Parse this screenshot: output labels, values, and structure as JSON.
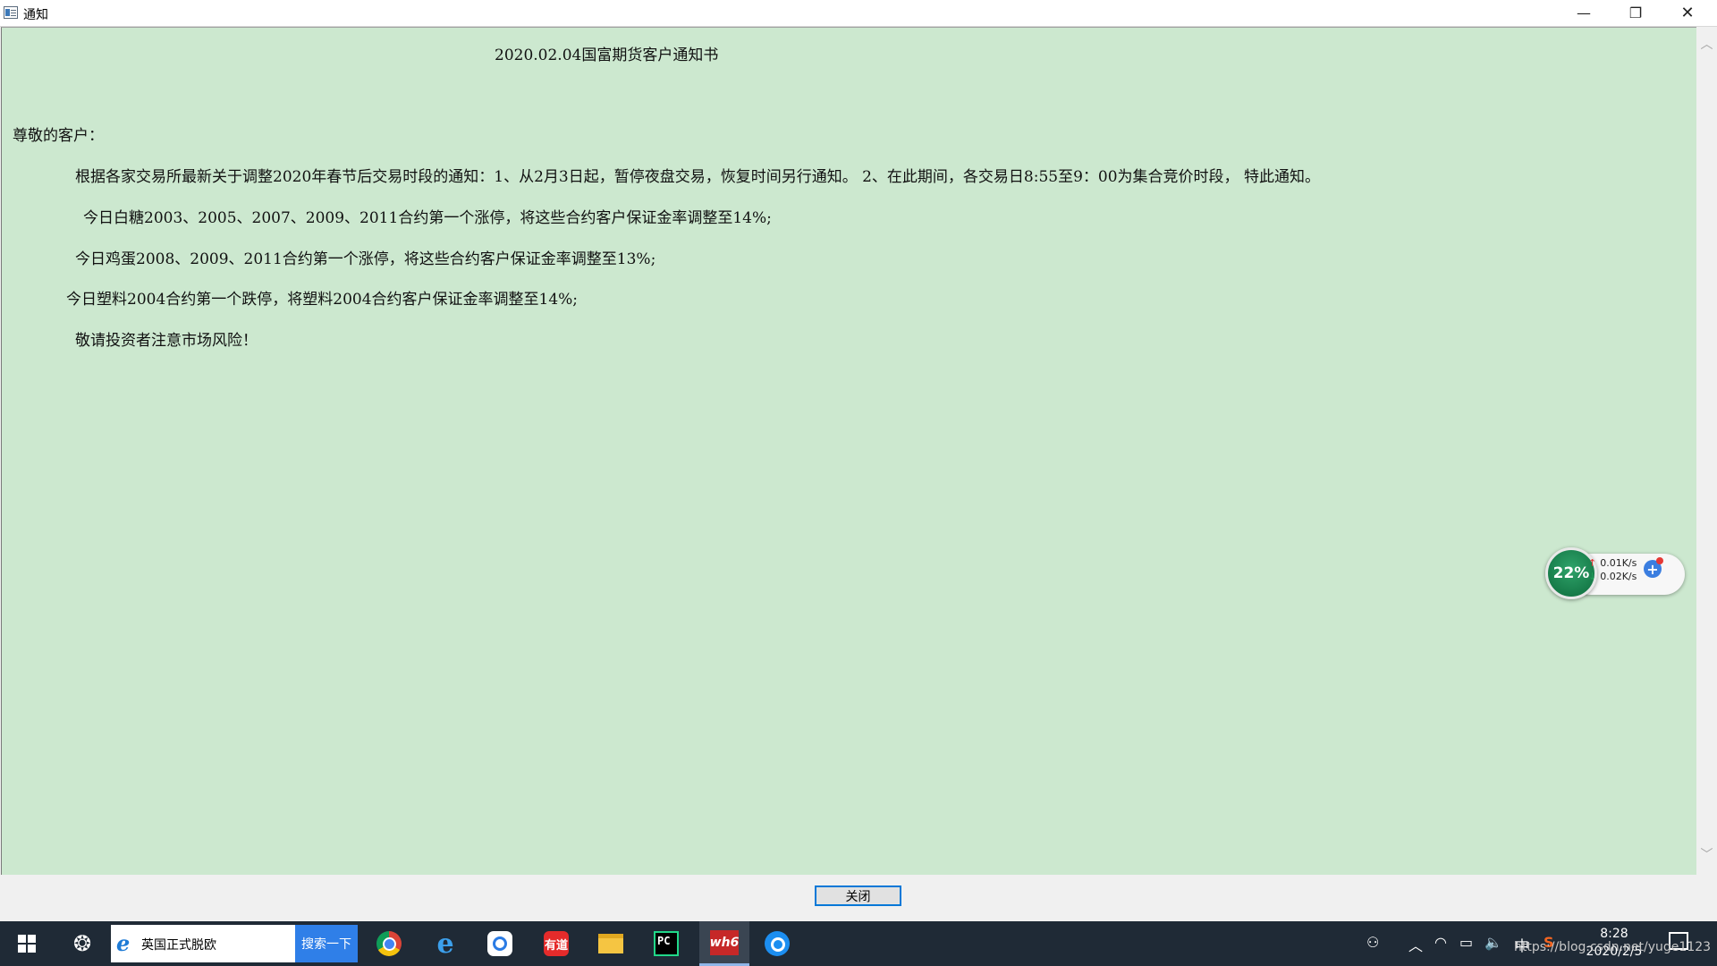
{
  "window": {
    "title": "通知",
    "controls": {
      "minimize": "—",
      "maximize": "❐",
      "close": "✕"
    }
  },
  "notice": {
    "title": "2020.02.04国富期货客户通知书",
    "greeting": "尊敬的客户：",
    "paragraphs": [
      "根据各家交易所最新关于调整2020年春节后交易时段的通知：1、从2月3日起，暂停夜盘交易，恢复时间另行通知。 2、在此期间，各交易日8:55至9：00为集合竞价时段， 特此通知。",
      "今日白糖2003、2005、2007、2009、2011合约第一个涨停，将这些合约客户保证金率调整至14%;",
      "今日鸡蛋2008、2009、2011合约第一个涨停，将这些合约客户保证金率调整至13%;",
      "今日塑料2004合约第一个跌停，将塑料2004合约客户保证金率调整至14%;",
      "敬请投资者注意市场风险！"
    ]
  },
  "scrollbar": {
    "up": "︿",
    "down": "﹀"
  },
  "dialog": {
    "close_button": "关闭"
  },
  "network_widget": {
    "cpu_usage": "22%",
    "upload": "0.01K/s",
    "download": "0.02K/s",
    "up_arrow": "↑",
    "down_arrow": "↓",
    "boost": "+"
  },
  "taskbar": {
    "search_text": "英国正式脱欧",
    "search_button": "搜索一下",
    "youdao_label": "有道",
    "pycharm_label": "PC",
    "wh6_label": "wh6",
    "ime": "中",
    "sogou": "S",
    "time": "8:28",
    "date": "2020/2/5",
    "icons": [
      "start-icon",
      "cortana-icon",
      "ie-icon",
      "chrome-icon",
      "edge-icon",
      "baidu-netdisk-icon",
      "youdao-icon",
      "file-explorer-icon",
      "pycharm-icon",
      "wenhua-wh6-icon",
      "qq-browser-icon"
    ]
  },
  "tray": {
    "people": "⚇",
    "chevron": "︿",
    "wifi": "◠",
    "battery": "▭",
    "volume": "🔈"
  },
  "watermark": "https://blog.csdn.net/yuge1123",
  "colors": {
    "content_bg": "#cce8cf",
    "taskbar_bg": "#1f2a36",
    "accent": "#0078d7",
    "cpu_green": "#0d6b3c"
  }
}
